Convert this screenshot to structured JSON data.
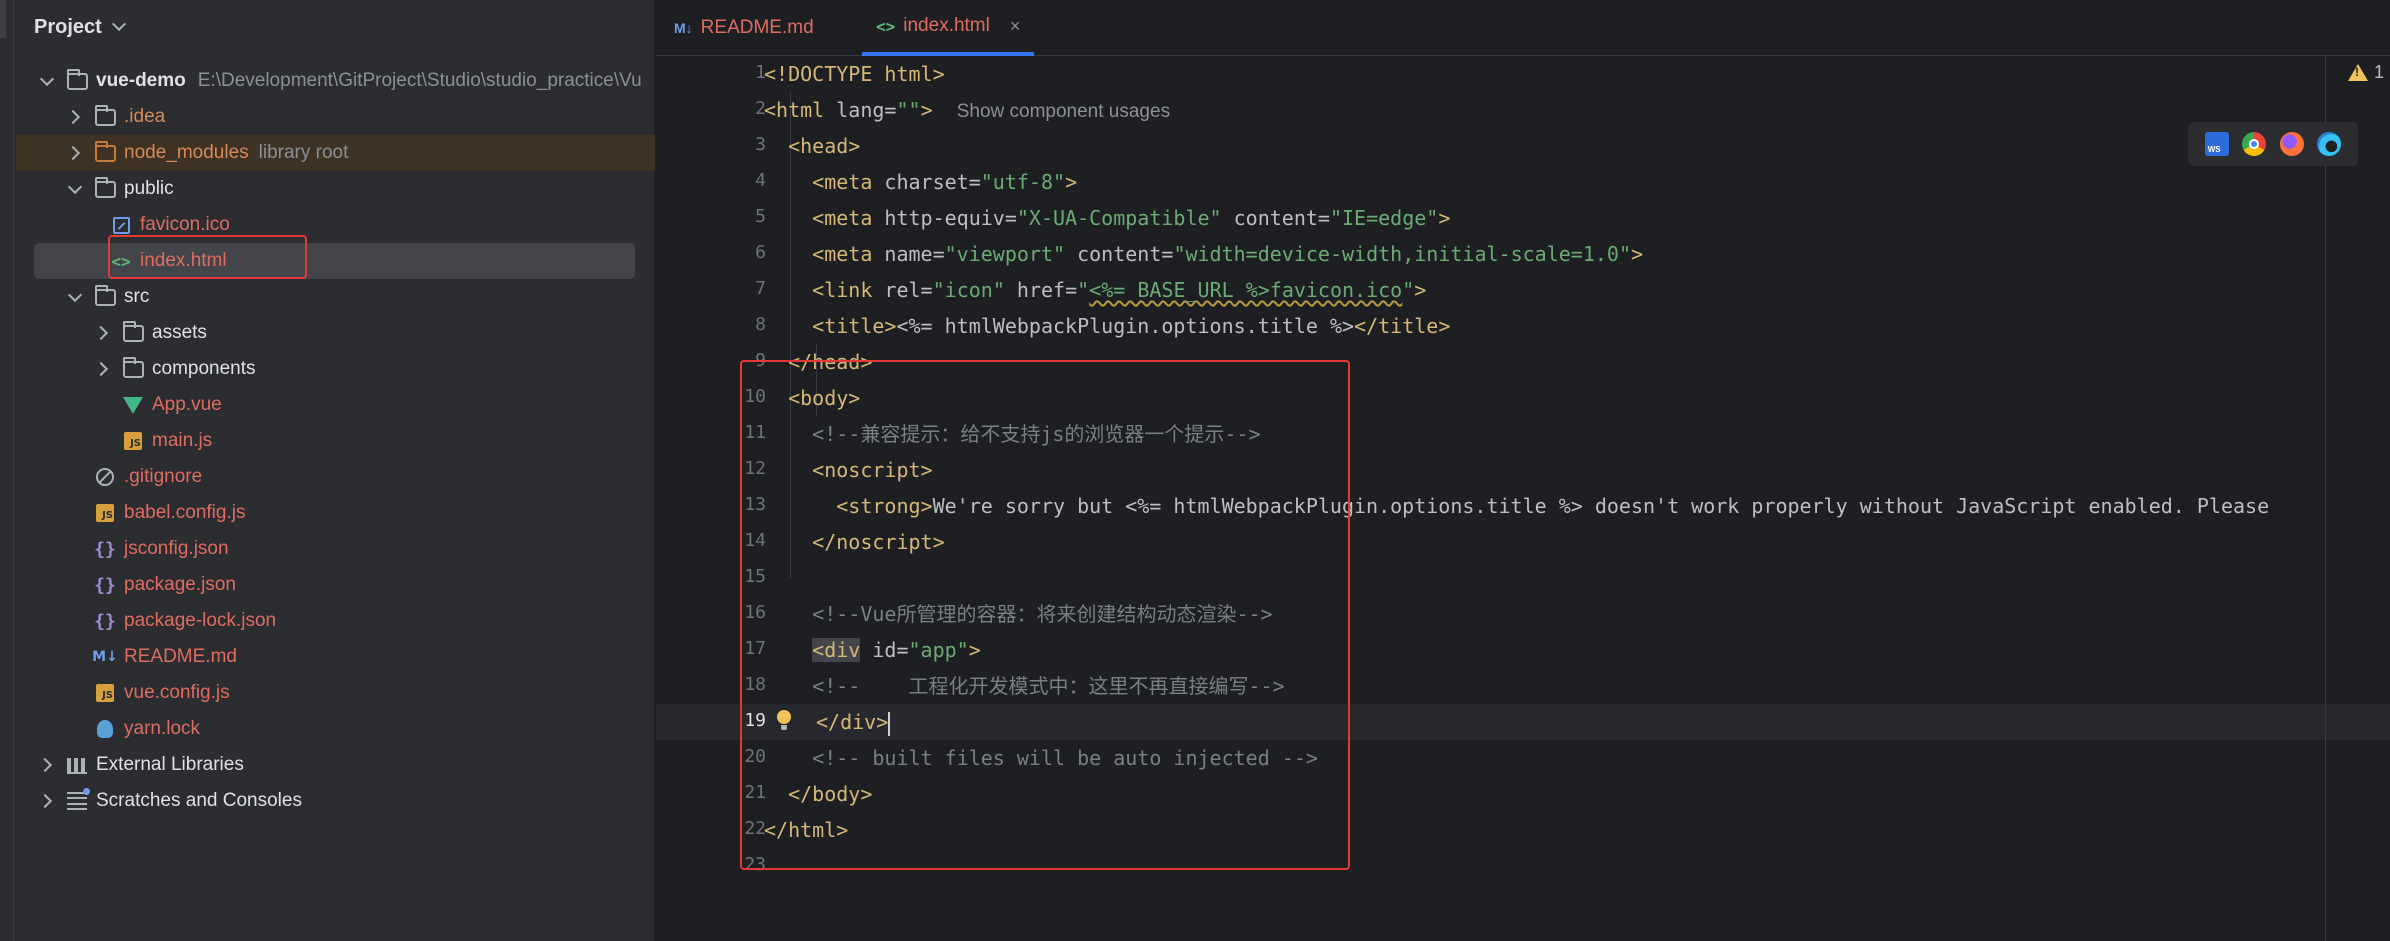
{
  "sidebar": {
    "title": "Project",
    "tree": [
      {
        "label": "vue-demo",
        "path": "E:\\Development\\GitProject\\Studio\\studio_practice\\Vu",
        "expanded": true
      },
      {
        "label": ".idea"
      },
      {
        "label": "node_modules",
        "hint": "library root"
      },
      {
        "label": "public",
        "expanded": true
      },
      {
        "label": "favicon.ico"
      },
      {
        "label": "index.html"
      },
      {
        "label": "src",
        "expanded": true
      },
      {
        "label": "assets"
      },
      {
        "label": "components"
      },
      {
        "label": "App.vue"
      },
      {
        "label": "main.js"
      },
      {
        "label": ".gitignore"
      },
      {
        "label": "babel.config.js"
      },
      {
        "label": "jsconfig.json"
      },
      {
        "label": "package.json"
      },
      {
        "label": "package-lock.json"
      },
      {
        "label": "README.md"
      },
      {
        "label": "vue.config.js"
      },
      {
        "label": "yarn.lock"
      },
      {
        "label": "External Libraries"
      },
      {
        "label": "Scratches and Consoles"
      }
    ]
  },
  "tabs": [
    {
      "icon": "M↓",
      "label": "README.md"
    },
    {
      "icon": "<>",
      "label": "index.html",
      "close": "×",
      "active": true
    }
  ],
  "editor": {
    "warning_count": "1",
    "line_numbers": [
      "1",
      "2",
      "3",
      "4",
      "5",
      "6",
      "7",
      "8",
      "9",
      "10",
      "11",
      "12",
      "13",
      "14",
      "15",
      "16",
      "17",
      "18",
      "19",
      "20",
      "21",
      "22",
      "23"
    ],
    "current_line": "19",
    "code": {
      "l1": "<!DOCTYPE html>",
      "l2_open": "<html",
      "l2_attr": " lang=",
      "l2_str": "\"\"",
      "l2_close": ">",
      "l2_usage": "Show component usages",
      "l3": "<head>",
      "l4_tag": "<meta",
      "l4_attr": " charset=",
      "l4_str": "\"utf-8\"",
      "l4_close": ">",
      "l5_tag": "<meta",
      "l5_attr1": " http-equiv=",
      "l5_str1": "\"X-UA-Compatible\"",
      "l5_attr2": " content=",
      "l5_str2": "\"IE=edge\"",
      "l5_close": ">",
      "l6_tag": "<meta",
      "l6_attr1": " name=",
      "l6_str1": "\"viewport\"",
      "l6_attr2": " content=",
      "l6_str2": "\"width=device-width,initial-scale=1.0\"",
      "l6_close": ">",
      "l7_tag": "<link",
      "l7_attr1": " rel=",
      "l7_str1": "\"icon\"",
      "l7_attr2": " href=",
      "l7_q": "\"",
      "l7_ul": "<%= BASE_URL %>favicon.ico",
      "l7_q2": "\"",
      "l7_close": ">",
      "l8_open": "<title>",
      "l8_txt": "<%= htmlWebpackPlugin.options.title %>",
      "l8_close": "</title>",
      "l9": "</head>",
      "l10": "<body>",
      "l11": "<!--兼容提示：给不支持js的浏览器一个提示-->",
      "l12": "<noscript>",
      "l13_open": "<strong>",
      "l13_txt": "We're sorry but <%= htmlWebpackPlugin.options.title %> doesn't work properly without JavaScript enabled. Please",
      "l14": "</noscript>",
      "l16": "<!--Vue所管理的容器：将来创建结构动态渲染-->",
      "l17_tag": "<div",
      "l17_attr": " id=",
      "l17_str": "\"app\"",
      "l17_close": ">",
      "l18": "<!--    工程化开发模式中：这里不再直接编写-->",
      "l19": "</div>",
      "l20": "<!-- built files will be auto injected -->",
      "l21": "</body>",
      "l22": "</html>"
    }
  },
  "browser_icons": [
    "webstorm-icon",
    "chrome-icon",
    "firefox-icon",
    "edge-icon"
  ],
  "colors": {
    "background": "#1e1f22",
    "sidebar": "#2b2d30",
    "tag": "#d5b778",
    "string": "#6aab73",
    "comment": "#7a7e85",
    "annotation": "#e53935",
    "accent": "#3574f0"
  }
}
